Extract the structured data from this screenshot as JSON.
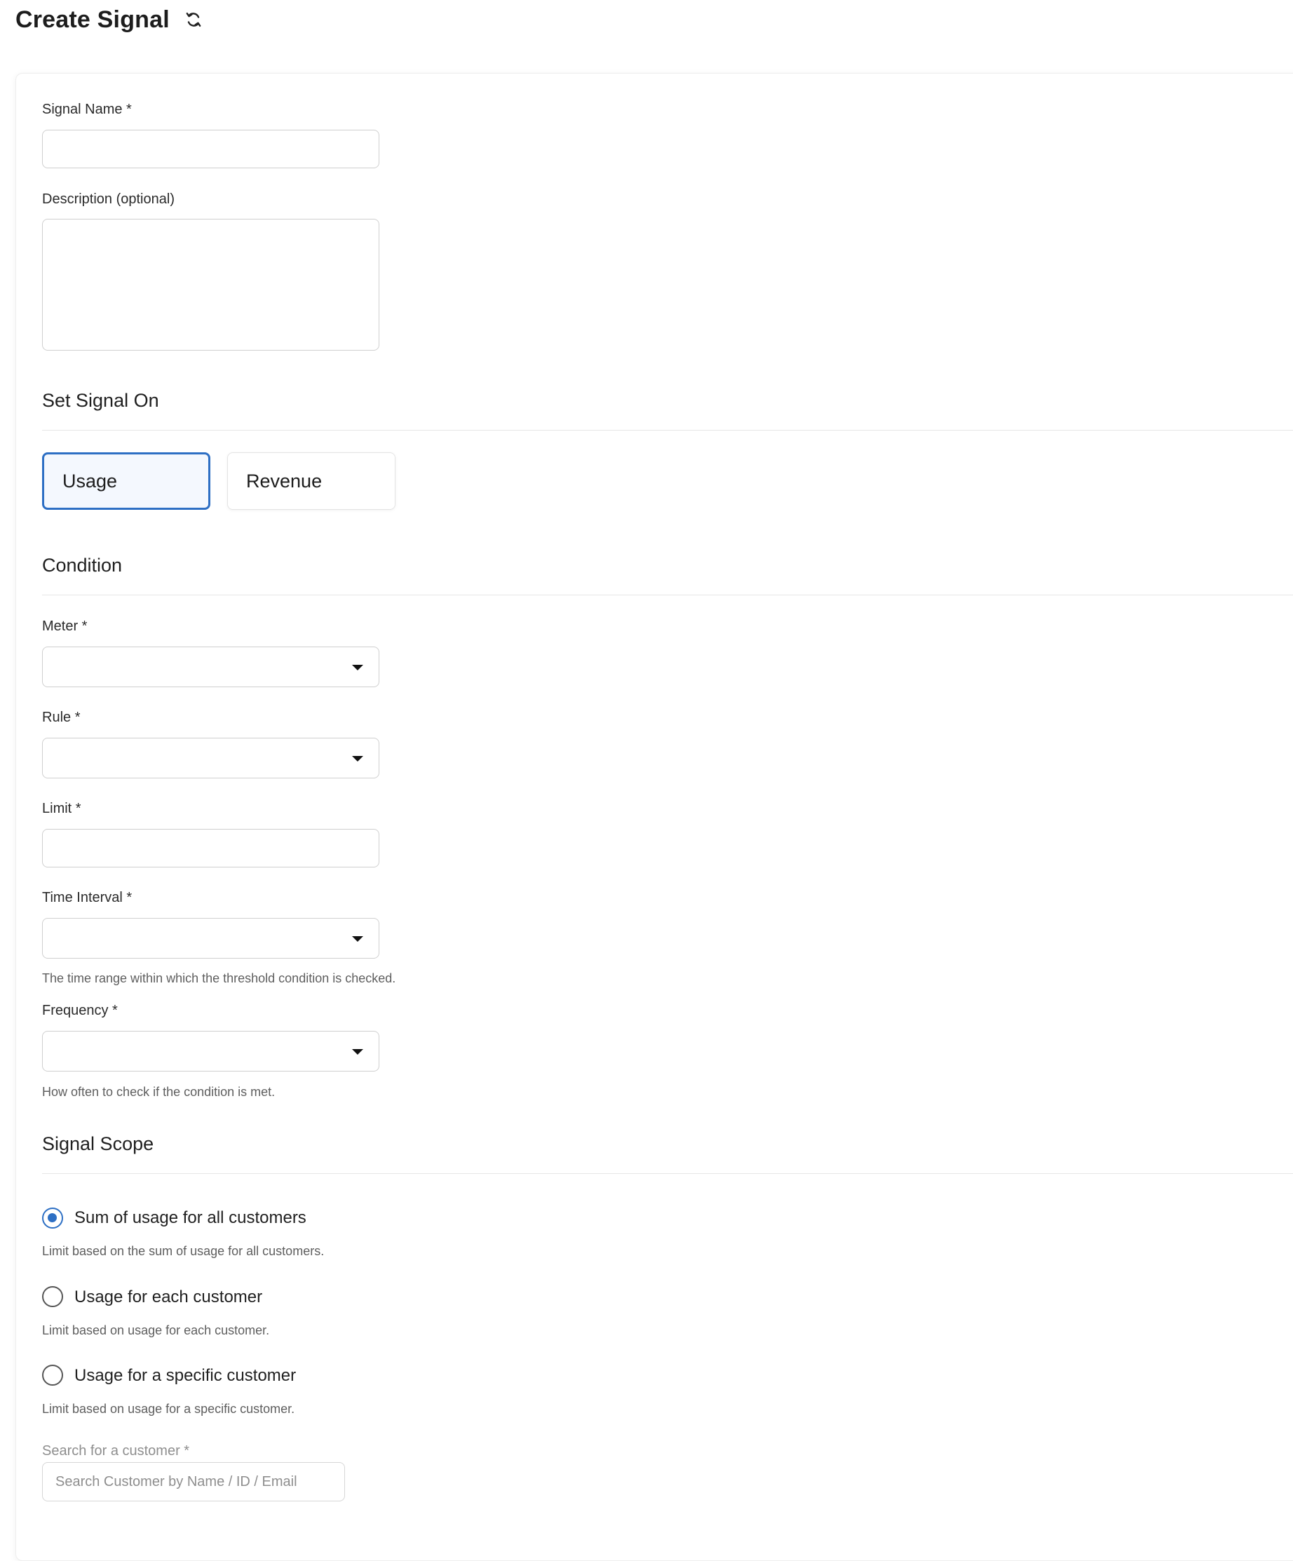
{
  "header": {
    "title": "Create Signal",
    "refresh_icon": "refresh-icon"
  },
  "form": {
    "signal_name": {
      "label": "Signal Name *",
      "value": "",
      "placeholder": ""
    },
    "description": {
      "label": "Description (optional)",
      "value": "",
      "placeholder": ""
    },
    "set_signal_on": {
      "title": "Set Signal On",
      "options": [
        {
          "label": "Usage",
          "selected": true
        },
        {
          "label": "Revenue",
          "selected": false
        }
      ]
    },
    "condition": {
      "title": "Condition",
      "meter": {
        "label": "Meter *",
        "value": ""
      },
      "rule": {
        "label": "Rule *",
        "value": ""
      },
      "limit": {
        "label": "Limit *",
        "value": "",
        "placeholder": ""
      },
      "time_interval": {
        "label": "Time Interval *",
        "value": "",
        "helper": "The time range within which the threshold condition is checked."
      },
      "frequency": {
        "label": "Frequency *",
        "value": "",
        "helper": "How often to check if the condition is met."
      }
    },
    "signal_scope": {
      "title": "Signal Scope",
      "options": [
        {
          "label": "Sum of usage for all customers",
          "helper": "Limit based on the sum of usage for all customers.",
          "checked": true
        },
        {
          "label": "Usage for each customer",
          "helper": "Limit based on usage for each customer.",
          "checked": false
        },
        {
          "label": "Usage for a specific customer",
          "helper": "Limit based on usage for a specific customer.",
          "checked": false
        }
      ],
      "customer_search": {
        "label": "Search for a customer *",
        "placeholder": "Search Customer by Name / ID / Email"
      }
    }
  },
  "colors": {
    "accent": "#2d6fc4",
    "border": "#cfcfcf",
    "helper_text": "#5e5e5e"
  }
}
